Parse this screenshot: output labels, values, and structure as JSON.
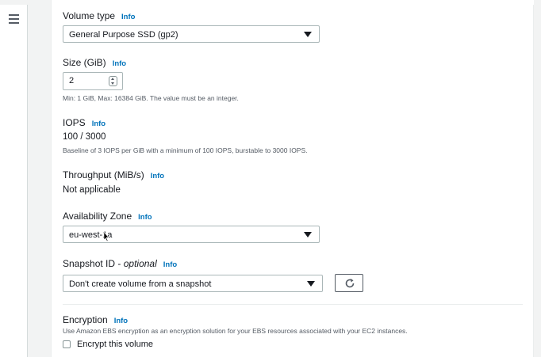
{
  "volume_type": {
    "label": "Volume type",
    "info": "Info",
    "selected": "General Purpose SSD (gp2)"
  },
  "size": {
    "label": "Size (GiB)",
    "info": "Info",
    "value": "2",
    "hint": "Min: 1 GiB, Max: 16384 GiB. The value must be an integer."
  },
  "iops": {
    "label": "IOPS",
    "info": "Info",
    "value": "100 / 3000",
    "hint": "Baseline of 3 IOPS per GiB with a minimum of 100 IOPS, burstable to 3000 IOPS."
  },
  "throughput": {
    "label": "Throughput (MiB/s)",
    "info": "Info",
    "value": "Not applicable"
  },
  "availability_zone": {
    "label": "Availability Zone",
    "info": "Info",
    "selected": "eu-west-1a"
  },
  "snapshot": {
    "label": "Snapshot ID - ",
    "label_optional": "optional",
    "info": "Info",
    "selected": "Don't create volume from a snapshot"
  },
  "encryption": {
    "label": "Encryption",
    "info": "Info",
    "description": "Use Amazon EBS encryption as an encryption solution for your EBS resources associated with your EC2 instances.",
    "checkbox_label": "Encrypt this volume",
    "checked": false
  },
  "icons": {
    "menu": "hamburger-menu-icon",
    "caret": "caret-down-icon",
    "refresh": "refresh-icon",
    "spinner": "number-spinner-icon"
  },
  "colors": {
    "link": "#0073bb",
    "border": "#aab7b8",
    "text": "#16191f",
    "muted": "#545b64"
  }
}
